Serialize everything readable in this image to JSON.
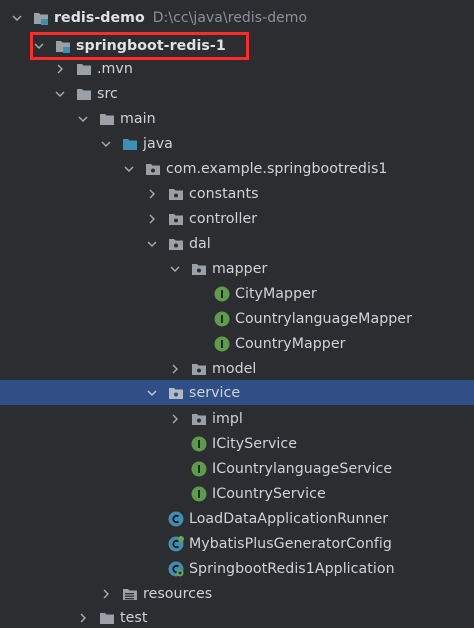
{
  "project_tree": {
    "root": {
      "label": "redis-demo",
      "path": "D:\\cc\\java\\redis-demo",
      "icon": "project-folder-icon",
      "expanded": true
    },
    "module": {
      "label": "springboot-redis-1",
      "icon": "module-folder-icon",
      "expanded": true,
      "highlighted": true
    },
    "mvn": {
      "label": ".mvn",
      "icon": "folder-icon",
      "expanded": false
    },
    "src": {
      "label": "src",
      "icon": "folder-icon",
      "expanded": true
    },
    "main": {
      "label": "main",
      "icon": "folder-icon",
      "expanded": true
    },
    "java": {
      "label": "java",
      "icon": "source-folder-icon",
      "expanded": true
    },
    "package": {
      "label": "com.example.springbootredis1",
      "icon": "package-icon",
      "expanded": true
    },
    "constants": {
      "label": "constants",
      "icon": "package-icon",
      "expanded": false
    },
    "controller": {
      "label": "controller",
      "icon": "package-icon",
      "expanded": false
    },
    "dal": {
      "label": "dal",
      "icon": "package-icon",
      "expanded": true
    },
    "mapper": {
      "label": "mapper",
      "icon": "package-icon",
      "expanded": true
    },
    "city_mapper": {
      "label": "CityMapper",
      "icon": "interface-icon"
    },
    "countrylanguage_mapper": {
      "label": "CountrylanguageMapper",
      "icon": "interface-icon"
    },
    "country_mapper": {
      "label": "CountryMapper",
      "icon": "interface-icon"
    },
    "model": {
      "label": "model",
      "icon": "package-icon",
      "expanded": false
    },
    "service": {
      "label": "service",
      "icon": "package-icon",
      "expanded": true,
      "selected": true
    },
    "impl": {
      "label": "impl",
      "icon": "package-icon",
      "expanded": false
    },
    "icity_service": {
      "label": "ICityService",
      "icon": "interface-icon"
    },
    "icountrylanguage_service": {
      "label": "ICountrylanguageService",
      "icon": "interface-icon"
    },
    "icountry_service": {
      "label": "ICountryService",
      "icon": "interface-icon"
    },
    "load_runner": {
      "label": "LoadDataApplicationRunner",
      "icon": "class-icon"
    },
    "generator_config": {
      "label": "MybatisPlusGeneratorConfig",
      "icon": "config-class-icon"
    },
    "application": {
      "label": "SpringbootRedis1Application",
      "icon": "spring-boot-class-icon"
    },
    "resources": {
      "label": "resources",
      "icon": "resources-folder-icon",
      "expanded": false
    },
    "test": {
      "label": "test",
      "icon": "folder-icon",
      "expanded": false
    }
  },
  "colors": {
    "background": "#2b2d30",
    "selection": "#2f4f86",
    "highlight_border": "#ff2a2a",
    "text": "#cfd3da",
    "path_text": "#8c9099",
    "interface_green": "#5f9b4c",
    "class_blue": "#3f8fb0"
  }
}
